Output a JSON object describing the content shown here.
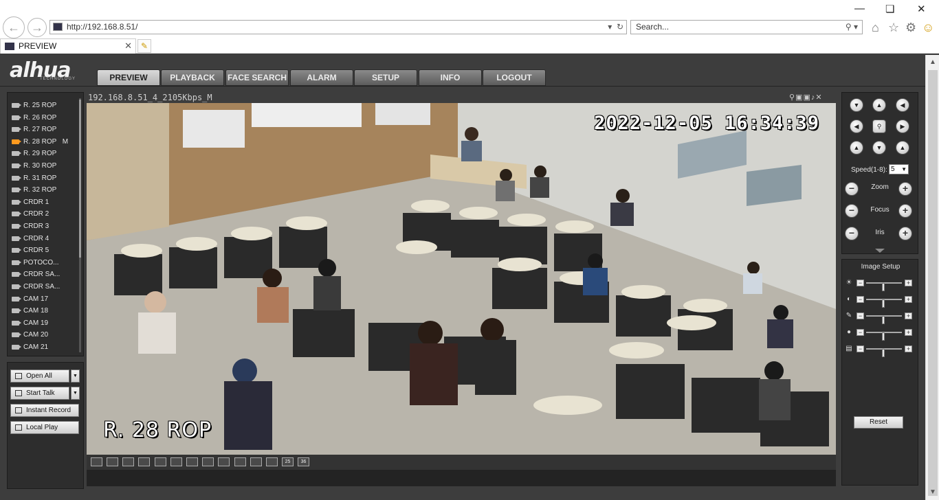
{
  "browser": {
    "url": "http://192.168.8.51/",
    "search_placeholder": "Search...",
    "tab_title": "PREVIEW"
  },
  "nav": {
    "tabs": [
      "PREVIEW",
      "PLAYBACK",
      "FACE SEARCH",
      "ALARM",
      "SETUP",
      "INFO",
      "LOGOUT"
    ],
    "active": "PREVIEW"
  },
  "cameras": [
    {
      "name": "R. 25 ROP",
      "badge": ""
    },
    {
      "name": "R. 26 ROP",
      "badge": ""
    },
    {
      "name": "R. 27 ROP",
      "badge": ""
    },
    {
      "name": "R. 28 ROP",
      "badge": "M"
    },
    {
      "name": "R. 29 ROP",
      "badge": ""
    },
    {
      "name": "R. 30 ROP",
      "badge": ""
    },
    {
      "name": "R. 31 ROP",
      "badge": ""
    },
    {
      "name": "R. 32 ROP",
      "badge": ""
    },
    {
      "name": "CRDR 1",
      "badge": ""
    },
    {
      "name": "CRDR 2",
      "badge": ""
    },
    {
      "name": "CRDR 3",
      "badge": ""
    },
    {
      "name": "CRDR 4",
      "badge": ""
    },
    {
      "name": "CRDR 5",
      "badge": ""
    },
    {
      "name": "POTOCO...",
      "badge": ""
    },
    {
      "name": "CRDR SA...",
      "badge": ""
    },
    {
      "name": "CRDR SA...",
      "badge": ""
    },
    {
      "name": "CAM 17",
      "badge": ""
    },
    {
      "name": "CAM 18",
      "badge": ""
    },
    {
      "name": "CAM 19",
      "badge": ""
    },
    {
      "name": "CAM 20",
      "badge": ""
    },
    {
      "name": "CAM 21",
      "badge": ""
    }
  ],
  "active_camera": "R. 28 ROP",
  "actions": {
    "open_all": "Open All",
    "start_talk": "Start Talk",
    "instant_record": "Instant Record",
    "local_play": "Local Play"
  },
  "video": {
    "stream_info": "192.168.8.51_4_2105Kbps_M",
    "timestamp": "2022-12-05 16:34:39",
    "camera_label": "R. 28 ROP"
  },
  "layouts": [
    "",
    "",
    "",
    "",
    "",
    "",
    "",
    "",
    "",
    "",
    "",
    "",
    "25",
    "36"
  ],
  "ptz": {
    "speed_label": "Speed(1-8):",
    "speed_value": "5",
    "zoom_label": "Zoom",
    "focus_label": "Focus",
    "iris_label": "Iris"
  },
  "image_setup": {
    "title": "Image Setup",
    "reset_label": "Reset",
    "sliders": [
      {
        "name": "brightness",
        "value": 0.5
      },
      {
        "name": "contrast",
        "value": 0.5
      },
      {
        "name": "saturation",
        "value": 0.5
      },
      {
        "name": "hue",
        "value": 0.5
      },
      {
        "name": "sharpness",
        "value": 0.5
      }
    ]
  }
}
